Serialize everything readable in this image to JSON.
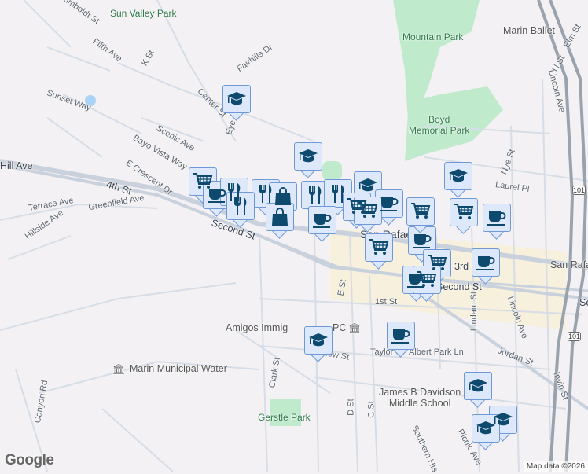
{
  "map": {
    "labels": {
      "sun_valley_park": "Sun Valley\nPark",
      "mountain_park": "Mountain Park",
      "marin_ballet": "Marin Ballet",
      "boyd_park": "Boyd\nMemorial Park",
      "humboldt": "Humboldt St",
      "fifth_ave": "Fifth Ave",
      "k_st": "K St",
      "fairhills": "Fairhills Dr",
      "center_st": "Center St",
      "eye_st": "Eye St",
      "sunset_way": "Sunset Way",
      "scenic_ave": "Scenic Ave",
      "bayo_vista": "Bayo Vista Way",
      "e_crescent": "E Crescent Dr",
      "hill_ave": "Hill Ave",
      "fourth_st": "4th St",
      "greenfield": "Greenfield Ave",
      "terrace": "Terrace Ave",
      "hillside": "Hillside Ave",
      "second_st": "Second St",
      "second_st_2": "Second St",
      "san_rafael": "San Rafael",
      "san_rafael_station": "San Rafael",
      "third": "3rd",
      "first_st": "1st St",
      "e_st": "E St",
      "d_st": "D St",
      "c_st": "C St",
      "lindaro": "Lindaro St",
      "lincoln_ave": "Lincoln Ave",
      "lincoln_ave_2": "Lincoln Ave",
      "elm_st": "Elm St",
      "nye_st": "Nye St",
      "laurel_pl": "Laurel Pl",
      "irwin": "Irwin St",
      "jordan": "Jordan St",
      "taylor": "Taylor St",
      "albert_park": "Albert Park Ln",
      "bayview": "Bayview St",
      "clark": "Clark St",
      "amigos": "Amigos Immig",
      "amigos_pc": "PC",
      "marin_water": "Marin Municipal Water",
      "canyon": "Canyon Rd",
      "gerstle": "Gerstle Park",
      "davidson": "James B Davidson\nMiddle School",
      "southern": "Southern Hts",
      "picnic": "Picnic Ave",
      "hwy101_a": "101",
      "hwy101_b": "101",
      "se": "Se",
      "sa": "Sa",
      "n_st": "N St"
    },
    "markers": [
      "school",
      "school",
      "cart",
      "cup",
      "cutlery",
      "cutlery",
      "cutlery",
      "bag",
      "cutlery",
      "bag",
      "cutlery",
      "school",
      "cart",
      "cup",
      "cart",
      "cup",
      "school",
      "cart",
      "cup",
      "cart",
      "cup",
      "cart",
      "cup",
      "cart",
      "cup",
      "cart",
      "school",
      "school",
      "school",
      "cup",
      "school"
    ],
    "logo": "Google",
    "attribution": "Map data ©2026",
    "colors": {
      "marker_fill": "#dde8fb",
      "marker_border": "#6f98d8",
      "icon": "#0d4a6e",
      "park": "#bfeacc",
      "downtown": "#f7f0dc"
    }
  }
}
